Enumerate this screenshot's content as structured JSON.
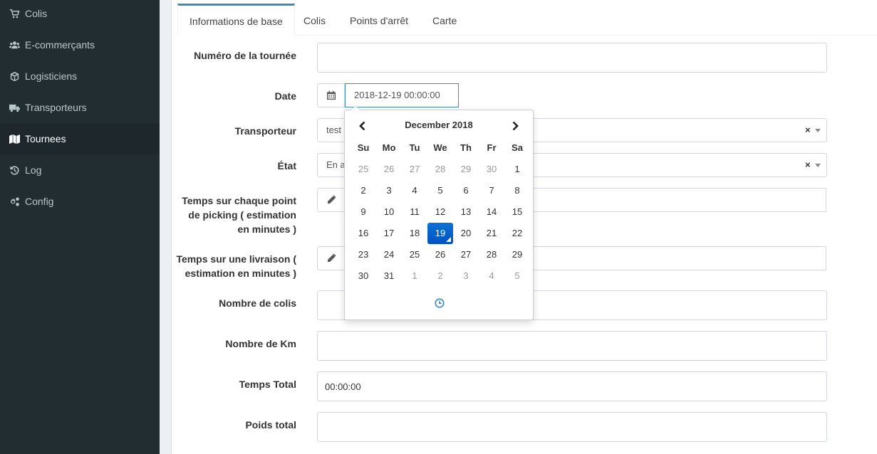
{
  "sidebar": {
    "items": [
      {
        "label": "Colis",
        "icon": "cart-icon"
      },
      {
        "label": "E-commerçants",
        "icon": "users-icon"
      },
      {
        "label": "Logisticiens",
        "icon": "cube-icon"
      },
      {
        "label": "Transporteurs",
        "icon": "truck-icon"
      },
      {
        "label": "Tournees",
        "icon": "map-icon"
      },
      {
        "label": "Log",
        "icon": "history-icon"
      },
      {
        "label": "Config",
        "icon": "cogs-icon"
      }
    ],
    "active_index": 4
  },
  "tabs": [
    {
      "label": "Informations de base"
    },
    {
      "label": "Colis"
    },
    {
      "label": "Points d'arrêt"
    },
    {
      "label": "Carte"
    }
  ],
  "form": {
    "numero_label": "Numéro de la tournée",
    "numero_value": "",
    "date_label": "Date",
    "date_value": "2018-12-19 00:00:00",
    "transporteur_label": "Transporteur",
    "transporteur_value": "test",
    "etat_label": "État",
    "etat_value": "En a",
    "clear_symbol": "×",
    "temps_picking_label_1": "Temps sur chaque point",
    "temps_picking_label_2": "de picking ( estimation",
    "temps_picking_label_3": "en minutes )",
    "temps_livraison_label_1": "Temps sur une livraison (",
    "temps_livraison_label_2": "estimation en minutes )",
    "nombre_colis_label": "Nombre de colis",
    "nombre_km_label": "Nombre de Km",
    "temps_total_label": "Temps Total",
    "temps_total_value": "00:00:00",
    "poids_total_label": "Poids total"
  },
  "datepicker": {
    "title": "December 2018",
    "weekdays": [
      "Su",
      "Mo",
      "Tu",
      "We",
      "Th",
      "Fr",
      "Sa"
    ],
    "weeks": [
      [
        "25",
        "26",
        "27",
        "28",
        "29",
        "30",
        "1"
      ],
      [
        "2",
        "3",
        "4",
        "5",
        "6",
        "7",
        "8"
      ],
      [
        "9",
        "10",
        "11",
        "12",
        "13",
        "14",
        "15"
      ],
      [
        "16",
        "17",
        "18",
        "19",
        "20",
        "21",
        "22"
      ],
      [
        "23",
        "24",
        "25",
        "26",
        "27",
        "28",
        "29"
      ],
      [
        "30",
        "31",
        "1",
        "2",
        "3",
        "4",
        "5"
      ]
    ],
    "selected_day": "19"
  },
  "colors": {
    "sidebar_bg": "#222d32",
    "sidebar_active_bg": "#1e282c",
    "tab_accent": "#3c8dbc",
    "selected_day": "#0063cc",
    "clock_icon": "#3c8dbc"
  }
}
